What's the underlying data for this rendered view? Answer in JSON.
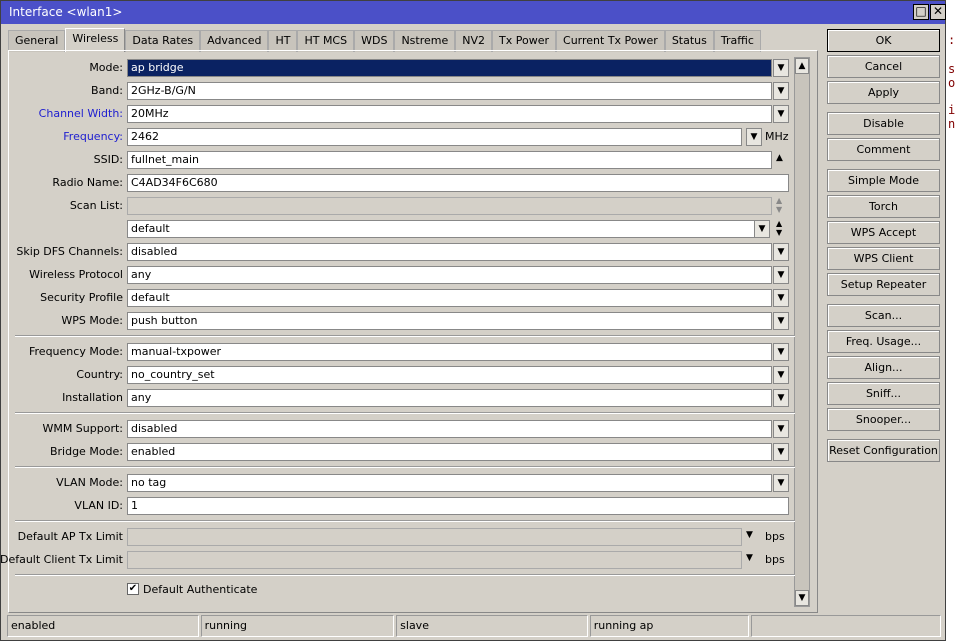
{
  "window": {
    "title": "Interface <wlan1>",
    "maximize_icon": "maximize-icon",
    "close_icon": "close-icon"
  },
  "tabs": [
    "General",
    "Wireless",
    "Data Rates",
    "Advanced",
    "HT",
    "HT MCS",
    "WDS",
    "Nstreme",
    "NV2",
    "Tx Power",
    "Current Tx Power",
    "Status",
    "Traffic"
  ],
  "active_tab": "Wireless",
  "fields": {
    "mode": {
      "label": "Mode:",
      "value": "ap bridge"
    },
    "band": {
      "label": "Band:",
      "value": "2GHz-B/G/N"
    },
    "channel_width": {
      "label": "Channel Width:",
      "value": "20MHz"
    },
    "frequency": {
      "label": "Frequency:",
      "value": "2462",
      "unit": "MHz"
    },
    "ssid": {
      "label": "SSID:",
      "value": "fullnet_main"
    },
    "radio_name": {
      "label": "Radio Name:",
      "value": "C4AD34F6C680"
    },
    "scan_list": {
      "label": "Scan List:",
      "value": ""
    },
    "scan_list_2": {
      "value": "default"
    },
    "skip_dfs": {
      "label": "Skip DFS Channels:",
      "value": "disabled"
    },
    "wireless_protocol": {
      "label": "Wireless Protocol",
      "value": "any"
    },
    "security_profile": {
      "label": "Security Profile",
      "value": "default"
    },
    "wps_mode": {
      "label": "WPS Mode:",
      "value": "push button"
    },
    "frequency_mode": {
      "label": "Frequency Mode:",
      "value": "manual-txpower"
    },
    "country": {
      "label": "Country:",
      "value": "no_country_set"
    },
    "installation": {
      "label": "Installation",
      "value": "any"
    },
    "wmm_support": {
      "label": "WMM Support:",
      "value": "disabled"
    },
    "bridge_mode": {
      "label": "Bridge Mode:",
      "value": "enabled"
    },
    "vlan_mode": {
      "label": "VLAN Mode:",
      "value": "no tag"
    },
    "vlan_id": {
      "label": "VLAN ID:",
      "value": "1"
    },
    "ap_tx_limit": {
      "label": "Default AP Tx Limit",
      "value": "",
      "unit": "bps"
    },
    "client_tx_limit": {
      "label": "Default Client Tx Limit",
      "value": "",
      "unit": "bps"
    },
    "default_authenticate": {
      "label": "Default Authenticate",
      "checked": true
    }
  },
  "buttons": [
    "OK",
    "Cancel",
    "Apply",
    "Disable",
    "Comment",
    "Simple Mode",
    "Torch",
    "WPS Accept",
    "WPS Client",
    "Setup Repeater",
    "Scan...",
    "Freq. Usage...",
    "Align...",
    "Sniff...",
    "Snooper...",
    "Reset Configuration"
  ],
  "status": [
    "enabled",
    "running",
    "slave",
    "running ap",
    ""
  ],
  "background_text": [
    ":",
    "s",
    "o",
    "i",
    "n"
  ]
}
